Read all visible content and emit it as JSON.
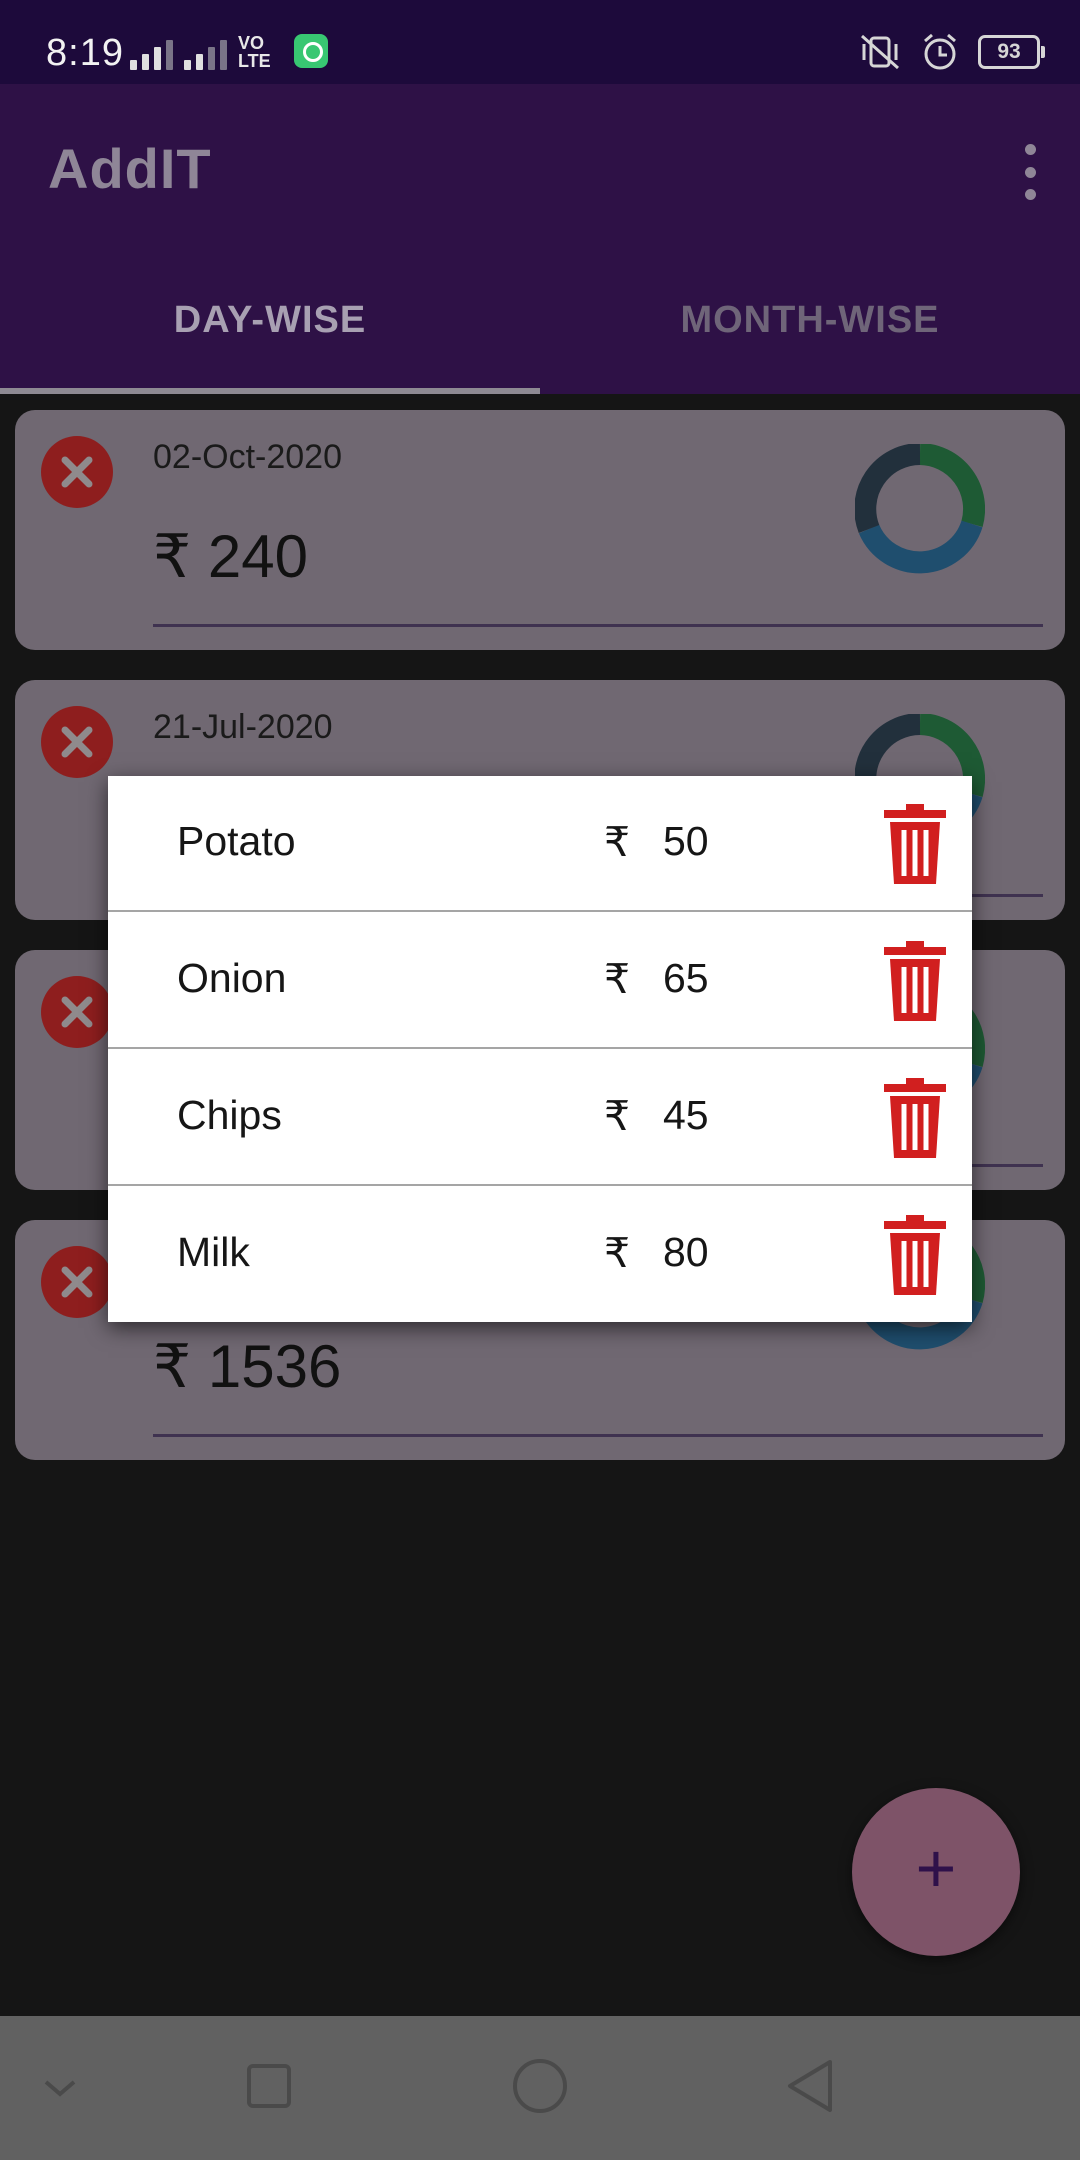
{
  "status_bar": {
    "time": "8:19",
    "network": "VO LTE",
    "battery": "93",
    "icons": [
      "signal-icon",
      "signal-icon",
      "volte-icon",
      "app-notification-icon",
      "vibrate-off-icon",
      "alarm-icon",
      "battery-icon"
    ]
  },
  "app_bar": {
    "title": "AddIT",
    "menu_icon": "more-vert-icon"
  },
  "tabs": [
    {
      "label": "DAY-WISE",
      "selected": true
    },
    {
      "label": "MONTH-WISE",
      "selected": false
    }
  ],
  "cards": [
    {
      "date": "02-Oct-2020",
      "amount": "₹ 240"
    },
    {
      "date": "21-Jul-2020",
      "amount": ""
    },
    {
      "date": "",
      "amount": ""
    },
    {
      "date": "",
      "amount": "₹ 1536"
    }
  ],
  "dialog": {
    "currency": "₹",
    "items": [
      {
        "name": "Potato",
        "price": "50"
      },
      {
        "name": "Onion",
        "price": "65"
      },
      {
        "name": "Chips",
        "price": "45"
      },
      {
        "name": "Milk",
        "price": "80"
      }
    ]
  },
  "fab": {
    "label": "+"
  },
  "colors": {
    "app_bar": "#2e1146",
    "card": "#706872",
    "delete_red": "#c62828",
    "fab": "#7e5368",
    "chart_blue": "#1f5f8b",
    "chart_green": "#1e7a3c",
    "chart_dark": "#22303c"
  }
}
